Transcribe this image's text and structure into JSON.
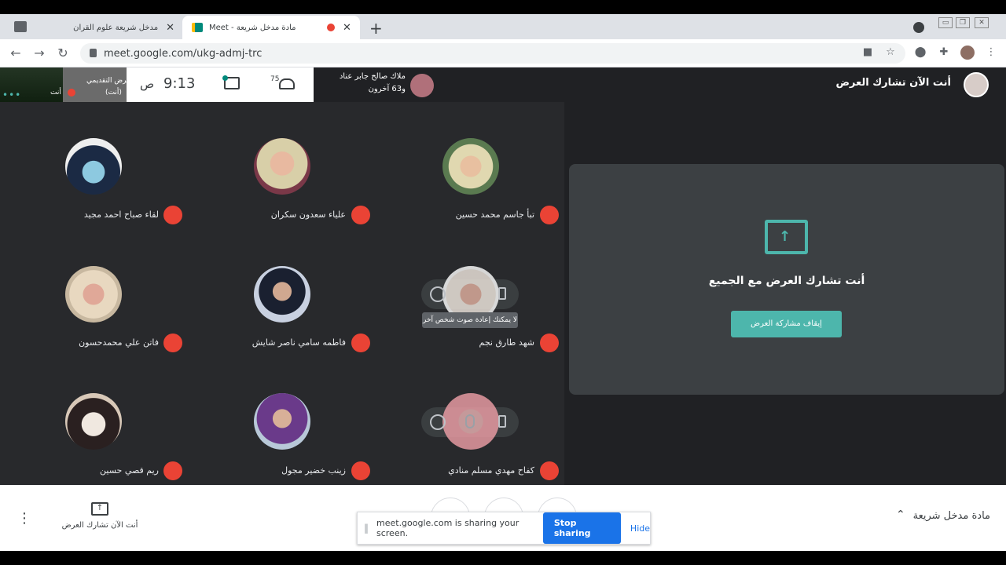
{
  "browser": {
    "tabs": [
      {
        "label": "مدخل شريعة علوم القران"
      },
      {
        "label": "Meet - مادة مدخل شريعة"
      }
    ],
    "new_tab_symbol": "+",
    "url": "meet.google.com/ukg-admj-trc"
  },
  "meet": {
    "presenter": {
      "line1": "العرض التقديمي",
      "line2": "(أنت)",
      "you_label": "أنت"
    },
    "clock": {
      "time": "9:13",
      "period": "ص"
    },
    "participant_count": "75",
    "speaker": {
      "name": "ملاك صالح جابر عناد",
      "others": "و63 آخرون"
    },
    "header_title": "أنت الآن تشارك العرض",
    "participants": [
      {
        "name": "لقاء صباح احمد مجيد"
      },
      {
        "name": "علياء سعدون سكران"
      },
      {
        "name": "تبأ جاسم محمد حسين"
      },
      {
        "name": "فاتن علي محمدحسون"
      },
      {
        "name": "فاطمه سامي ناصر شايش"
      },
      {
        "name": "شهد طارق نجم"
      },
      {
        "name": "ريم قصي حسين"
      },
      {
        "name": "زينب خضير مجول"
      },
      {
        "name": "كفاح مهدي مسلم منادي"
      }
    ],
    "tooltip": "لا يمكنك إعادة صوت شخص آخر",
    "panel": {
      "title": "أنت تشارك العرض مع الجميع",
      "stop_button": "إيقاف مشاركة العرض"
    },
    "bottom": {
      "presenting_label": "أنت الآن تشارك العرض",
      "meeting_name": "مادة مدخل شريعة"
    },
    "sharebar": {
      "message": "meet.google.com is sharing your screen.",
      "stop": "Stop sharing",
      "hide": "Hide"
    }
  },
  "colors": {
    "accent": "#4db6ac",
    "mic_off": "#ea4335",
    "blue": "#1a73e8"
  }
}
